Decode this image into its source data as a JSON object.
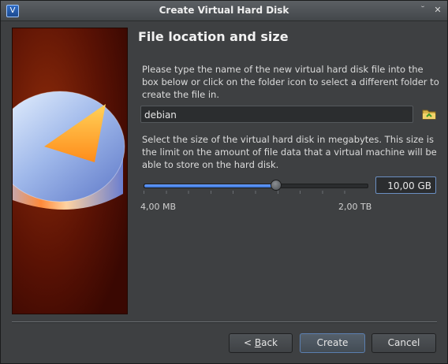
{
  "window": {
    "title": "Create Virtual Hard Disk",
    "app_icon": "V"
  },
  "page": {
    "heading": "File location and size",
    "location_instructions": "Please type the name of the new virtual hard disk file into the box below or click on the folder icon to select a different folder to create the file in.",
    "file_name": "debian",
    "size_instructions": "Select the size of the virtual hard disk in megabytes. This size is the limit on the amount of file data that a virtual machine will be able to store on the hard disk.",
    "size_value": "10,00 GB",
    "slider_min_label": "4,00 MB",
    "slider_max_label": "2,00 TB",
    "slider_fraction": 0.59
  },
  "buttons": {
    "back": "< Back",
    "back_accel": "B",
    "create": "Create",
    "cancel": "Cancel"
  },
  "colors": {
    "accent": "#3a74d6",
    "side_background": "#6a1a05"
  }
}
